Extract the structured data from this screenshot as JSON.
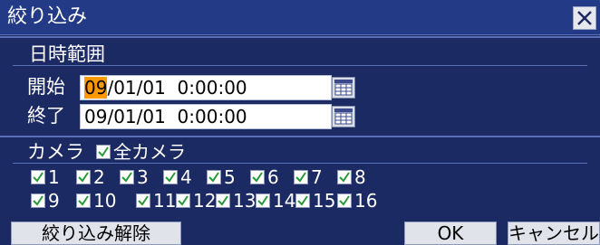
{
  "dialog": {
    "title": "絞り込み",
    "datetime_section": {
      "heading": "日時範囲",
      "start_label": "開始",
      "start_value_selected": "09",
      "start_value_rest": "/01/01  0:00:00",
      "end_label": "終了",
      "end_value": "09/01/01  0:00:00"
    },
    "camera_section": {
      "heading": "カメラ",
      "all_cameras_label": "全カメラ",
      "all_cameras_checked": true,
      "cameras": [
        {
          "label": "1",
          "checked": true
        },
        {
          "label": "2",
          "checked": true
        },
        {
          "label": "3",
          "checked": true
        },
        {
          "label": "4",
          "checked": true
        },
        {
          "label": "5",
          "checked": true
        },
        {
          "label": "6",
          "checked": true
        },
        {
          "label": "7",
          "checked": true
        },
        {
          "label": "8",
          "checked": true
        },
        {
          "label": "9",
          "checked": true
        },
        {
          "label": "10",
          "checked": true
        },
        {
          "label": "11",
          "checked": true
        },
        {
          "label": "12",
          "checked": true
        },
        {
          "label": "13",
          "checked": true
        },
        {
          "label": "14",
          "checked": true
        },
        {
          "label": "15",
          "checked": true
        },
        {
          "label": "16",
          "checked": true
        }
      ]
    },
    "buttons": {
      "clear_filter": "絞り込み解除",
      "ok": "OK",
      "cancel": "キャンセル"
    }
  },
  "colors": {
    "background": "#1c2a63",
    "titlebar": "#233a86",
    "selection_highlight": "#ff9900",
    "checkmark": "#2a9a3a"
  }
}
